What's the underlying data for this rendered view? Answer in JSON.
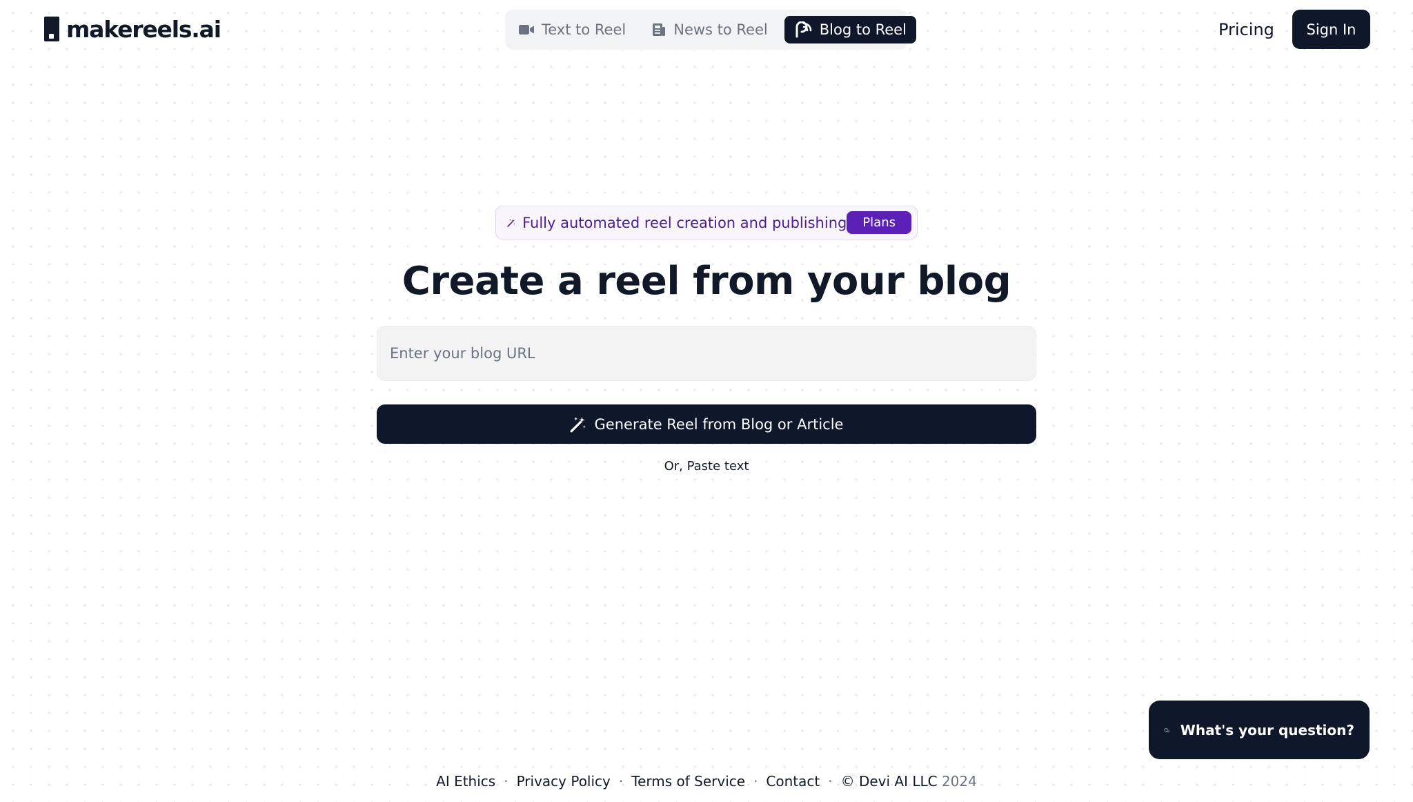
{
  "brand": {
    "name": "makereels.ai"
  },
  "nav": {
    "tabs": [
      {
        "label": "Text to Reel",
        "icon": "video-camera-icon",
        "active": false
      },
      {
        "label": "News to Reel",
        "icon": "newspaper-icon",
        "active": false
      },
      {
        "label": "Blog to Reel",
        "icon": "blog-feed-icon",
        "active": true
      }
    ],
    "pricing_label": "Pricing",
    "signin_label": "Sign In"
  },
  "hero": {
    "pill_text": "Fully automated reel creation and publishing",
    "pill_badge": "Plans",
    "title": "Create a reel from your blog",
    "url_placeholder": "Enter your blog URL",
    "url_value": "",
    "generate_label": "Generate Reel from Blog or Article",
    "paste_text_label": "Or, Paste text"
  },
  "chat": {
    "label": "What's your question?"
  },
  "footer": {
    "links": [
      "AI Ethics",
      "Privacy Policy",
      "Terms of Service",
      "Contact"
    ],
    "copyright_prefix": "© Devi AI LLC",
    "copyright_year": "2024"
  },
  "colors": {
    "primary": "#0f172a",
    "accent_purple": "#5b21b6",
    "pill_text": "#4c1d95",
    "input_bg": "#f3f3f4"
  }
}
